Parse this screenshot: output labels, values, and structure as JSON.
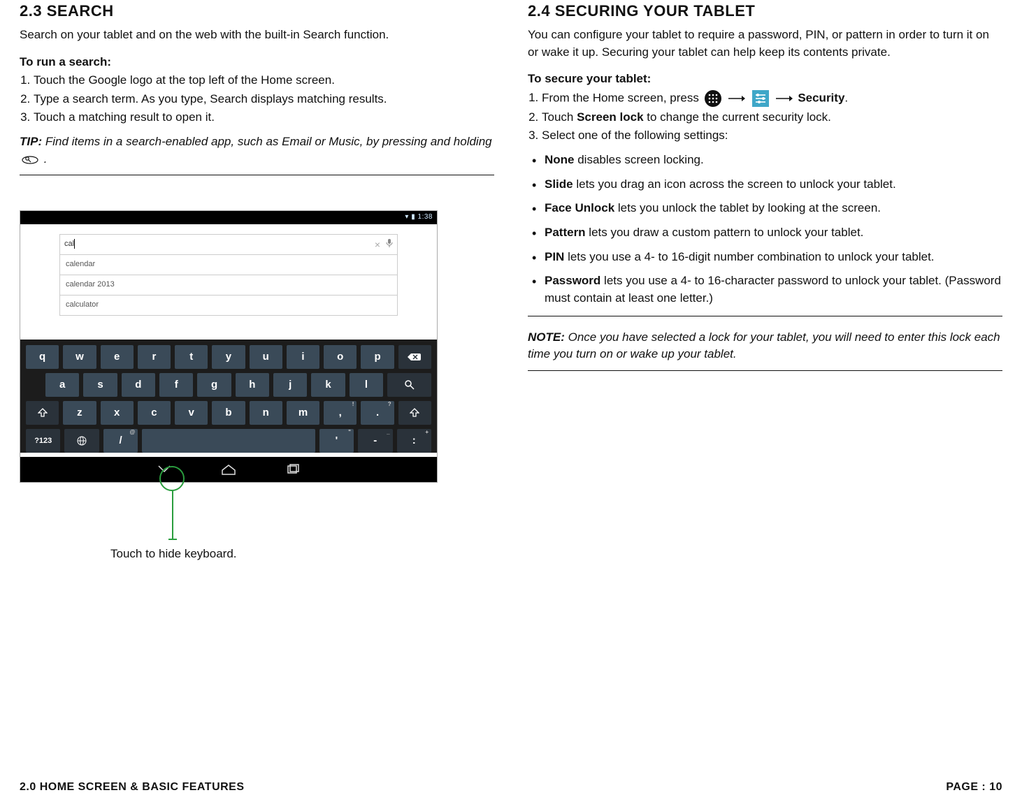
{
  "left": {
    "heading": "2.3 SEARCH",
    "intro": "Search on your tablet and on the web with the built-in Search function.",
    "runHead": "To run a search:",
    "steps": [
      "Touch the Google logo at the top left of the Home screen.",
      "Type a search term. As you type, Search displays matching results.",
      "Touch a matching result to open it."
    ],
    "tipLabel": "TIP:",
    "tipBody1": "Find items in a search-enabled app, such as Email or Music, by pressing and holding ",
    "tipBody2": ".",
    "tablet": {
      "time": "1:38",
      "searchValue": "cal",
      "suggestions": [
        "calendar",
        "calendar 2013",
        "calculator"
      ],
      "rows": {
        "r1": [
          "q",
          "w",
          "e",
          "r",
          "t",
          "y",
          "u",
          "i",
          "o",
          "p"
        ],
        "r2": [
          "a",
          "s",
          "d",
          "f",
          "g",
          "h",
          "j",
          "k",
          "l"
        ],
        "r3": [
          "z",
          "x",
          "c",
          "v",
          "b",
          "n",
          "m",
          ",",
          "."
        ],
        "r4": {
          "symKey": "?123",
          "slash": "/",
          "apos": "'",
          "dash": "-",
          "colon": ":"
        }
      }
    },
    "callout": "Touch to hide keyboard."
  },
  "right": {
    "heading": "2.4 SECURING YOUR TABLET",
    "intro": "You can configure your tablet to require a password, PIN, or pattern in order to turn it on or wake it up. Securing your tablet can help keep its contents private.",
    "secureHead": "To secure your tablet:",
    "step1_pre": "From the Home screen, press ",
    "step1_security": "Security",
    "step1_post": ".",
    "step2_pre": "Touch ",
    "step2_bold": "Screen lock",
    "step2_post": " to change the current security lock.",
    "step3": "Select one of the following settings:",
    "opts": [
      {
        "b": "None",
        "t": " disables screen locking."
      },
      {
        "b": "Slide",
        "t": " lets you drag an icon across the screen to unlock your tablet."
      },
      {
        "b": "Face Unlock",
        "t": " lets you unlock the tablet by looking at the screen."
      },
      {
        "b": "Pattern",
        "t": " lets you draw a custom pattern to unlock your tablet."
      },
      {
        "b": "PIN",
        "t": " lets you use a 4- to 16-digit number combination to unlock your tablet."
      },
      {
        "b": "Password",
        "t": " lets you use a 4- to 16-character password to unlock your tablet. (Password must contain at least one letter.)"
      }
    ],
    "noteLabel": "NOTE:",
    "noteBody": "Once you have selected a lock for your tablet, you will need to enter this lock each time you turn on or wake up your tablet."
  },
  "footer": {
    "left": "2.0 HOME SCREEN & BASIC FEATURES",
    "right": "PAGE : 10"
  }
}
